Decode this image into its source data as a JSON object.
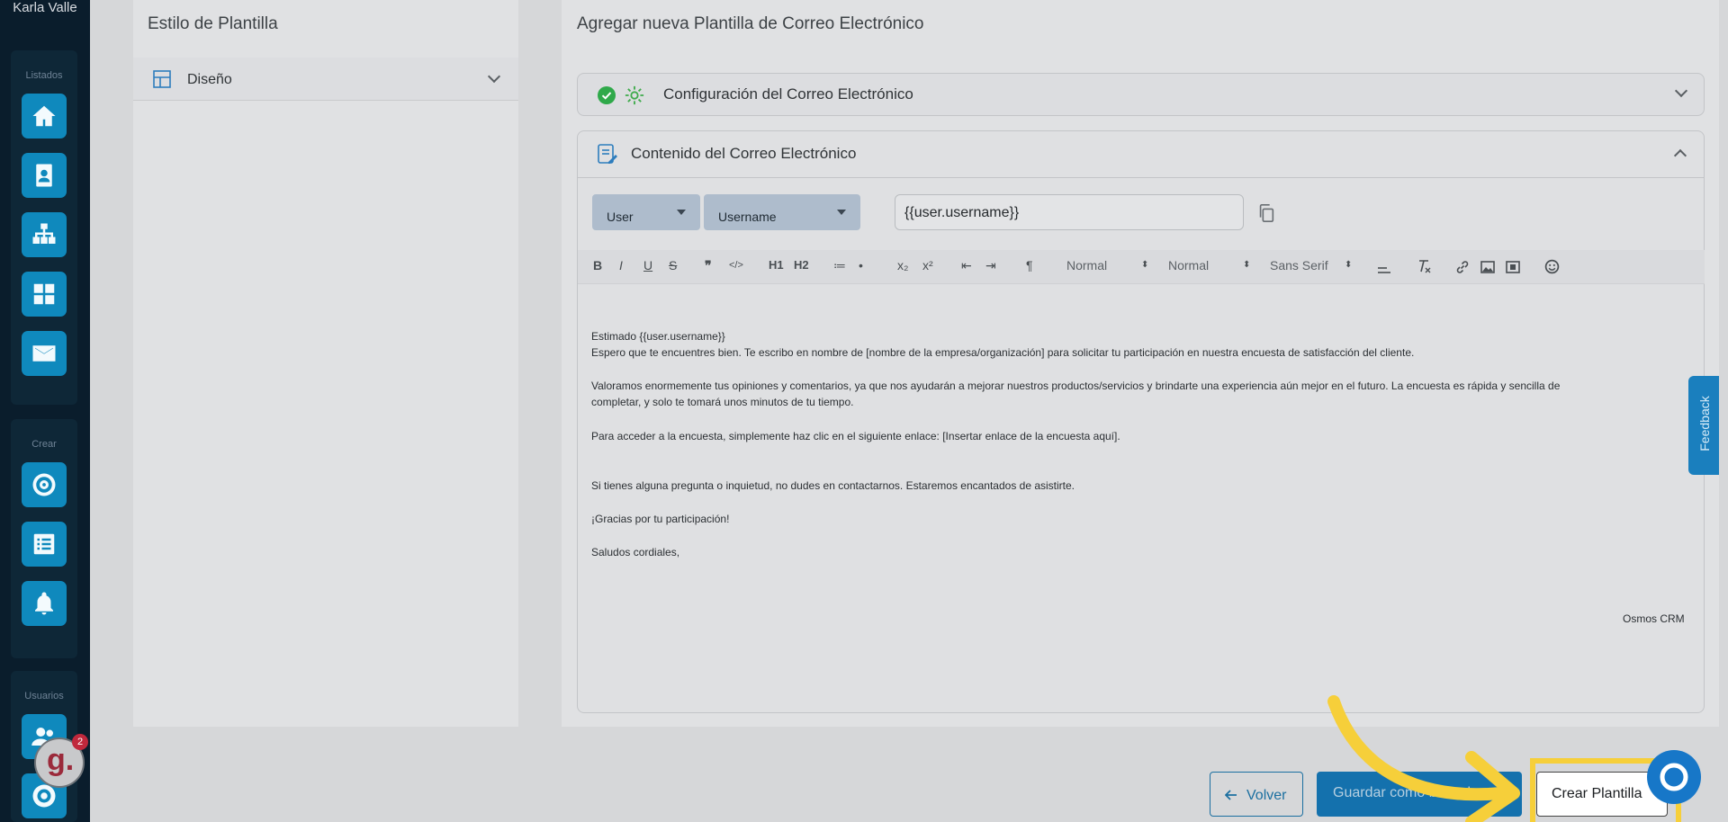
{
  "sidebar": {
    "user_name": "Karla Valle",
    "groups": [
      {
        "label": "Listados",
        "items": [
          "home-icon",
          "contacts-icon",
          "org-chart-icon",
          "dashboard-icon",
          "mail-icon"
        ]
      },
      {
        "label": "Crear",
        "items": [
          "target-icon",
          "checklist-icon",
          "bell-icon"
        ]
      },
      {
        "label": "Usuarios",
        "items": [
          "users-icon",
          "settings-icon"
        ]
      }
    ],
    "notification_count": "2",
    "logo_text": "g."
  },
  "style_panel": {
    "title": "Estilo de Plantilla",
    "design_label": "Diseño"
  },
  "template_panel": {
    "title": "Agregar nueva Plantilla de Correo Electrónico",
    "config_section": "Configuración del Correo Electrónico",
    "content_section": "Contenido del Correo Electrónico"
  },
  "variables": {
    "entity": "User",
    "field": "Username",
    "output": "{{user.username}}"
  },
  "toolbar": {
    "buttons": [
      "B",
      "I",
      "U",
      "S",
      "❞",
      "</>",
      "H1",
      "H2",
      "≔",
      "•",
      "x₂",
      "x²",
      "⇤",
      "⇥",
      "¶"
    ],
    "size_select": "Normal",
    "header_select": "Normal",
    "font_select": "Sans Serif"
  },
  "email_body": {
    "greeting": "Estimado {{user.username}}",
    "p1": "Espero que te encuentres bien. Te escribo en nombre de [nombre de la empresa/organización] para solicitar tu participación en nuestra encuesta de satisfacción del cliente.",
    "p2a": "Valoramos enormemente tus opiniones y comentarios, ya que nos ayudarán a mejorar nuestros productos/servicios y brindarte una experiencia aún mejor en el futuro. La encuesta es rápida y sencilla de",
    "p2b": "completar, y solo te tomará unos minutos de tu tiempo.",
    "p3": "Para acceder a la encuesta, simplemente haz clic en el siguiente enlace: [Insertar enlace de la encuesta aquí].",
    "p4": "Si tienes alguna pregunta o inquietud, no dudes en contactarnos. Estaremos encantados de asistirte.",
    "p5": "¡Gracias por tu participación!",
    "p6": "Saludos cordiales,",
    "signature": "Osmos CRM"
  },
  "feedback_tab": "Feedback",
  "actions": {
    "back": "Volver",
    "save_draft": "Guardar como borrador",
    "create": "Crear Plantilla"
  },
  "colors": {
    "sidebar_bg": "#0a1d2c",
    "sidebar_button": "#0f89bd",
    "primary": "#1471ad",
    "highlight": "#f6cf3a",
    "success": "#2fa94a"
  }
}
